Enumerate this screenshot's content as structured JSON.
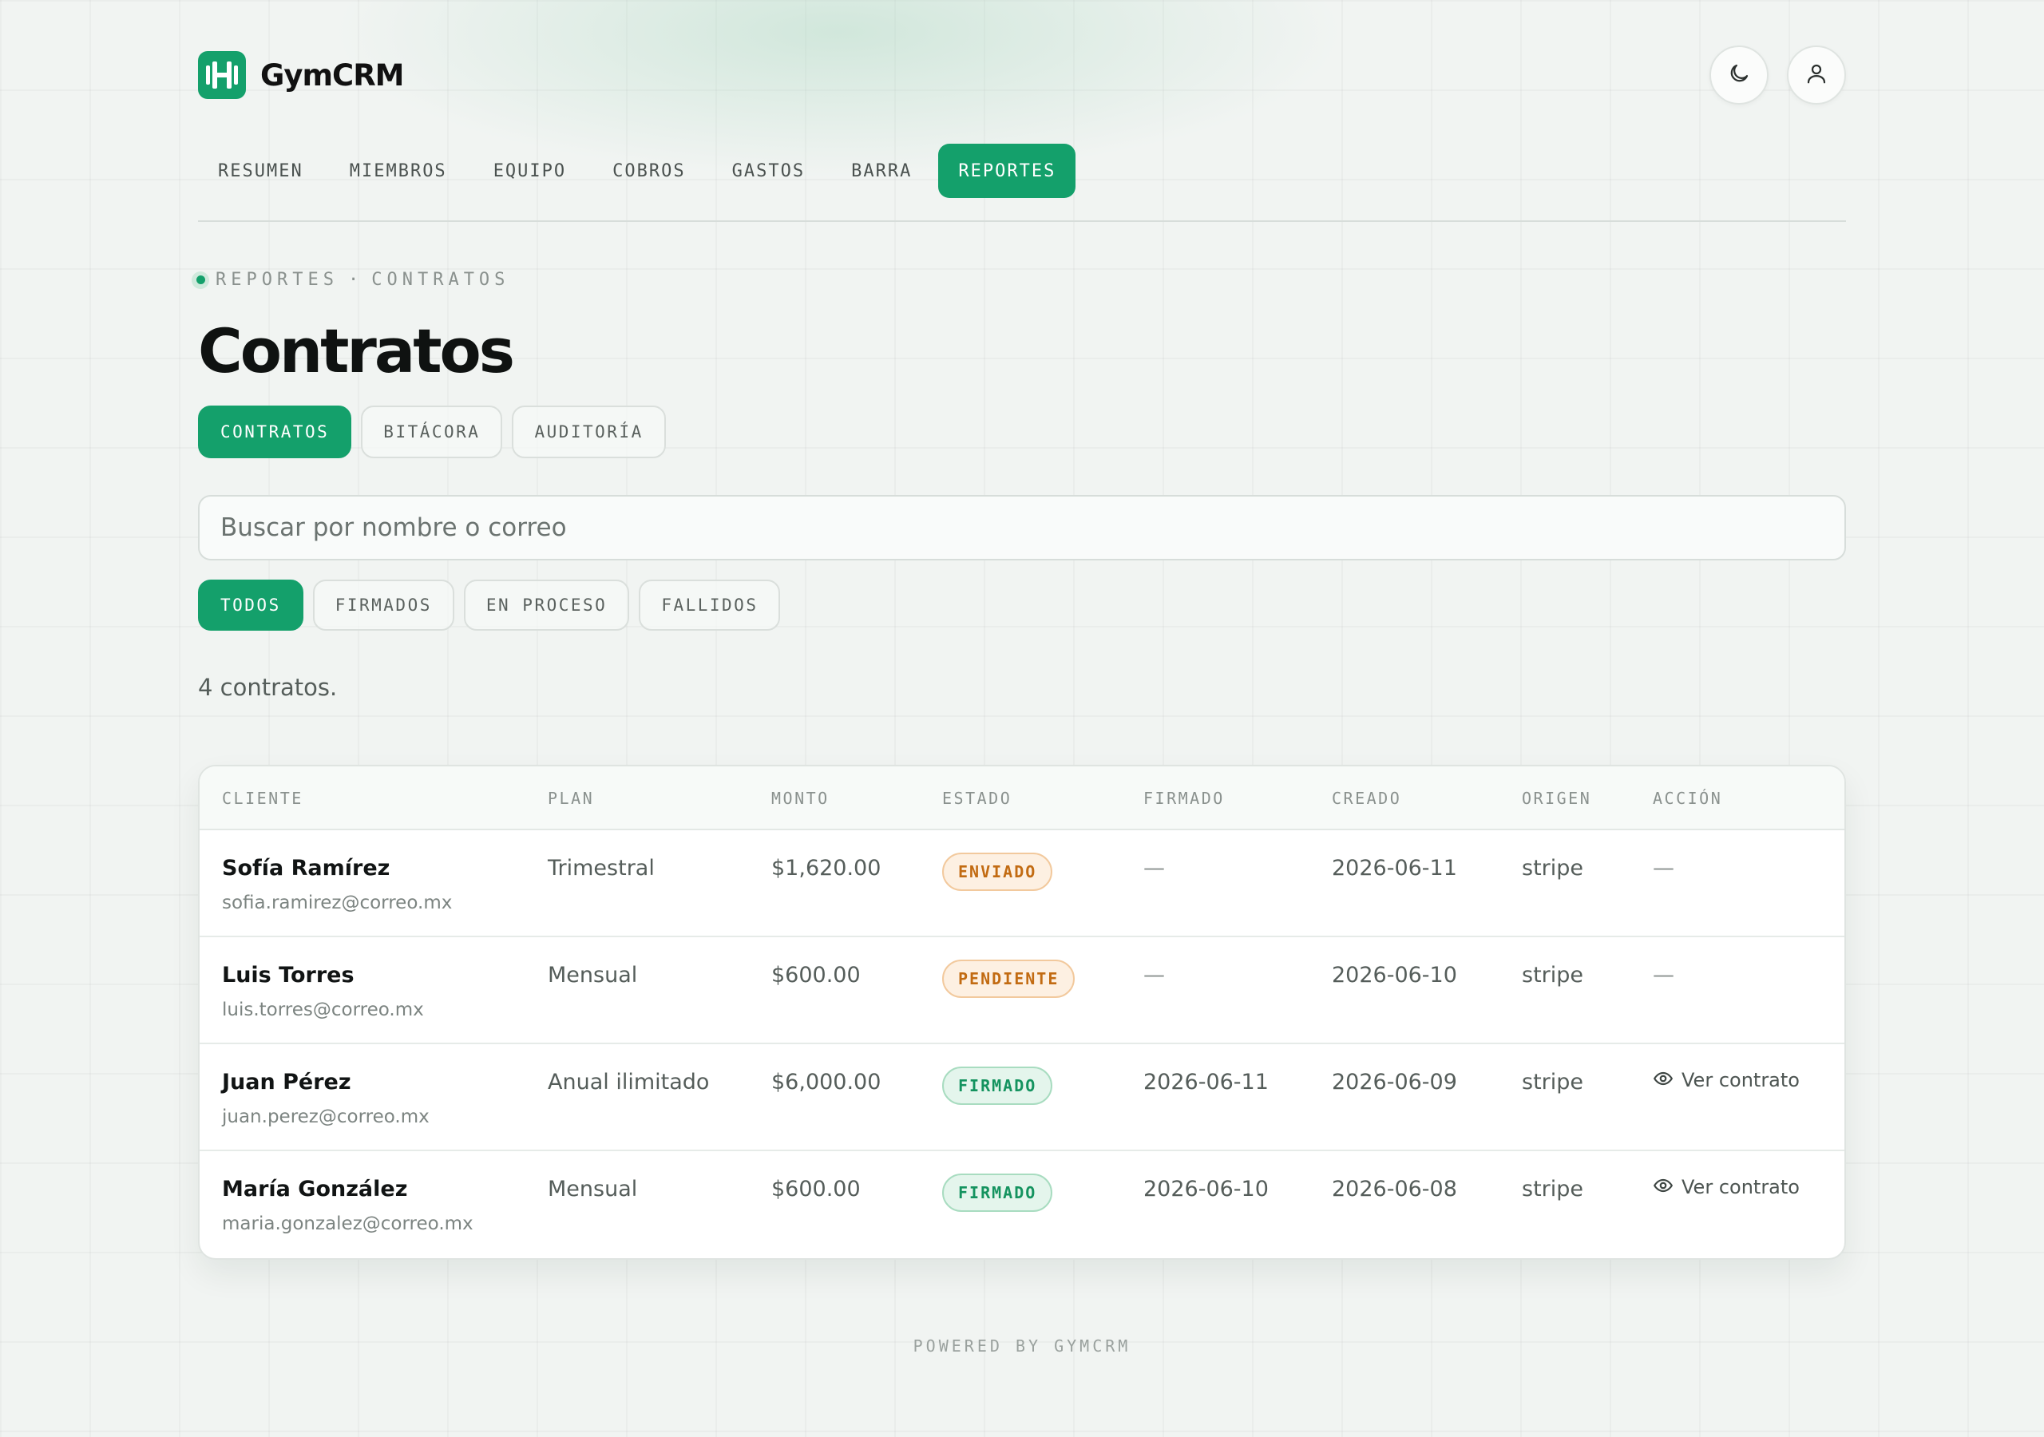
{
  "app": {
    "name": "GymCRM",
    "icons": {
      "logo": "barbell-logo-icon",
      "theme": "moon-icon",
      "account": "user-icon"
    }
  },
  "colors": {
    "accent": "#14a06b",
    "pending": "#c26b12",
    "signed": "#14935f"
  },
  "nav": [
    {
      "label": "RESUMEN",
      "active": false
    },
    {
      "label": "MIEMBROS",
      "active": false
    },
    {
      "label": "EQUIPO",
      "active": false
    },
    {
      "label": "COBROS",
      "active": false
    },
    {
      "label": "GASTOS",
      "active": false
    },
    {
      "label": "BARRA",
      "active": false
    },
    {
      "label": "REPORTES",
      "active": true
    }
  ],
  "breadcrumb": {
    "section": "REPORTES",
    "separator": "·",
    "page": "CONTRATOS"
  },
  "page": {
    "title": "Contratos"
  },
  "tabs": [
    {
      "label": "CONTRATOS",
      "active": true
    },
    {
      "label": "BITÁCORA",
      "active": false
    },
    {
      "label": "AUDITORÍA",
      "active": false
    }
  ],
  "search": {
    "placeholder": "Buscar por nombre o correo",
    "value": ""
  },
  "filters": [
    {
      "label": "TODOS",
      "active": true
    },
    {
      "label": "FIRMADOS",
      "active": false
    },
    {
      "label": "EN PROCESO",
      "active": false
    },
    {
      "label": "FALLIDOS",
      "active": false
    }
  ],
  "summary": {
    "count_text": "4 contratos."
  },
  "table": {
    "headers": {
      "client": "CLIENTE",
      "plan": "PLAN",
      "amount": "MONTO",
      "status": "ESTADO",
      "signed": "FIRMADO",
      "created": "CREADO",
      "origin": "ORIGEN",
      "action": "ACCIÓN"
    },
    "rows": [
      {
        "name": "Sofía Ramírez",
        "email": "sofia.ramirez@correo.mx",
        "plan": "Trimestral",
        "amount": "$1,620.00",
        "status": "ENVIADO",
        "status_tone": "orange",
        "signed": "—",
        "created": "2026-06-11",
        "origin": "stripe",
        "action": "—"
      },
      {
        "name": "Luis Torres",
        "email": "luis.torres@correo.mx",
        "plan": "Mensual",
        "amount": "$600.00",
        "status": "PENDIENTE",
        "status_tone": "orange",
        "signed": "—",
        "created": "2026-06-10",
        "origin": "stripe",
        "action": "—"
      },
      {
        "name": "Juan Pérez",
        "email": "juan.perez@correo.mx",
        "plan": "Anual ilimitado",
        "amount": "$6,000.00",
        "status": "FIRMADO",
        "status_tone": "green",
        "signed": "2026-06-11",
        "created": "2026-06-09",
        "origin": "stripe",
        "action": "Ver contrato",
        "action_icon": "eye-icon"
      },
      {
        "name": "María González",
        "email": "maria.gonzalez@correo.mx",
        "plan": "Mensual",
        "amount": "$600.00",
        "status": "FIRMADO",
        "status_tone": "green",
        "signed": "2026-06-10",
        "created": "2026-06-08",
        "origin": "stripe",
        "action": "Ver contrato",
        "action_icon": "eye-icon"
      }
    ]
  },
  "footer": {
    "text": "POWERED BY GYMCRM"
  }
}
